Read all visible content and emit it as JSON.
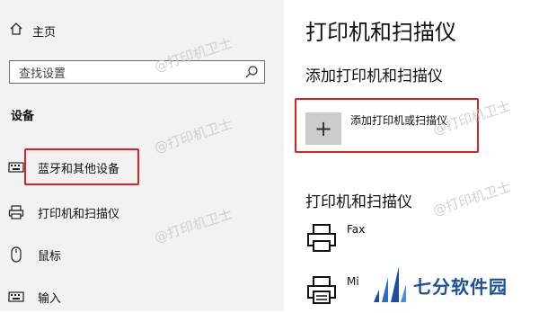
{
  "sidebar": {
    "home_label": "主页",
    "search_placeholder": "查找设置",
    "section_label": "设备",
    "items": [
      {
        "label": "蓝牙和其他设备",
        "icon": "keyboard-icon"
      },
      {
        "label": "打印机和扫描仪",
        "icon": "printer-icon"
      },
      {
        "label": "鼠标",
        "icon": "mouse-icon"
      },
      {
        "label": "输入",
        "icon": "keyboard-icon"
      }
    ]
  },
  "main": {
    "title": "打印机和扫描仪",
    "add_section_title": "添加打印机和扫描仪",
    "add_button_label": "添加打印机或扫描仪",
    "list_title": "打印机和扫描仪",
    "printers": [
      {
        "name": "Fax"
      },
      {
        "name": "Mi"
      }
    ]
  },
  "watermark_text": "@打印机卫士",
  "brand_text": "七分软件园",
  "colors": {
    "highlight": "#e02020",
    "sidebar_bg": "#f2f2f2",
    "brand": "#1b4f9c"
  }
}
